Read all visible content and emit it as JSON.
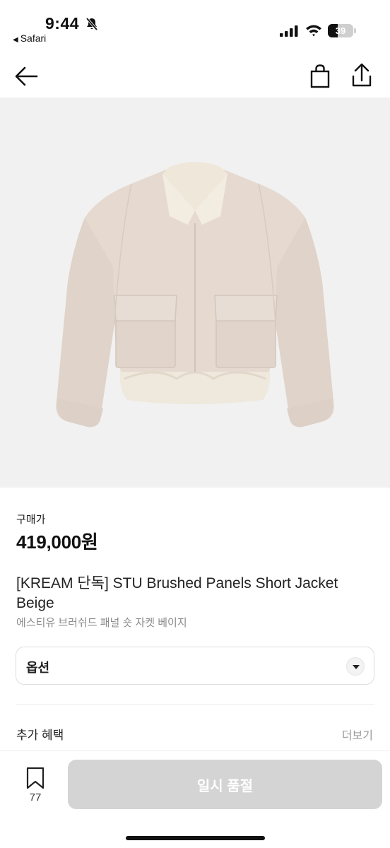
{
  "status_bar": {
    "time": "9:44",
    "back_app": "Safari",
    "battery": "39",
    "battery_level": 0.39
  },
  "product": {
    "price_label": "구매가",
    "price": "419,000원",
    "name": "[KREAM 단독] STU Brushed Panels Short Jacket Beige",
    "name_ko": "에스티유 브러쉬드 패널 숏 자켓 베이지"
  },
  "option": {
    "label": "옵션"
  },
  "benefits": {
    "title": "추가 혜택",
    "more": "더보기"
  },
  "bottom_bar": {
    "bookmark_count": "77",
    "action_label": "일시 품절"
  },
  "colors": {
    "image_background": "#f1f1f1",
    "jacket": "#e4d8cf",
    "disabled_button": "#d4d4d4"
  }
}
